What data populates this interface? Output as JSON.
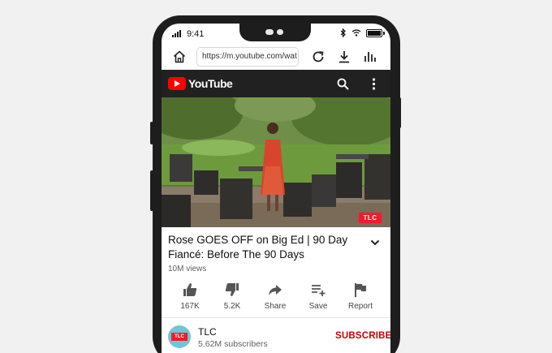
{
  "status_bar": {
    "time": "9:41"
  },
  "browser": {
    "url": "https://m.youtube.com/wat"
  },
  "youtube": {
    "logo_text": "YouTube",
    "brand_color": "#ff0000",
    "header_bg": "#212121"
  },
  "video": {
    "watermark": "TLC",
    "title": "Rose GOES OFF on Big Ed | 90 Day Fiancé: Before The 90 Days",
    "views": "10M views"
  },
  "actions": [
    {
      "label": "167K",
      "icon": "thumbs-up-icon"
    },
    {
      "label": "5.2K",
      "icon": "thumbs-down-icon"
    },
    {
      "label": "Share",
      "icon": "share-icon"
    },
    {
      "label": "Save",
      "icon": "playlist-add-icon"
    },
    {
      "label": "Report",
      "icon": "flag-icon"
    }
  ],
  "channel": {
    "avatar_text": "TLC",
    "name": "TLC",
    "subscribers": "5.62M subscribers",
    "subscribe_label": "SUBSCRIBE",
    "subscribe_color": "#cc0000"
  }
}
